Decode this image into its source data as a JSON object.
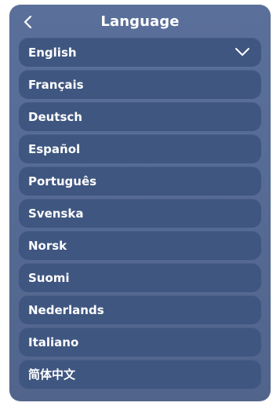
{
  "header": {
    "title": "Language",
    "back_icon": "chevron-left-icon"
  },
  "languages": [
    {
      "label": "English",
      "selected": true
    },
    {
      "label": "Français",
      "selected": false
    },
    {
      "label": "Deutsch",
      "selected": false
    },
    {
      "label": "Español",
      "selected": false
    },
    {
      "label": "Português",
      "selected": false
    },
    {
      "label": "Svenska",
      "selected": false
    },
    {
      "label": "Norsk",
      "selected": false
    },
    {
      "label": "Suomi",
      "selected": false
    },
    {
      "label": "Nederlands",
      "selected": false
    },
    {
      "label": "Italiano",
      "selected": false
    },
    {
      "label": "简体中文",
      "selected": false
    }
  ],
  "icons": {
    "selected": "check-icon"
  },
  "colors": {
    "panel": "#566b95",
    "item": "#3f5680",
    "text": "#ffffff"
  }
}
